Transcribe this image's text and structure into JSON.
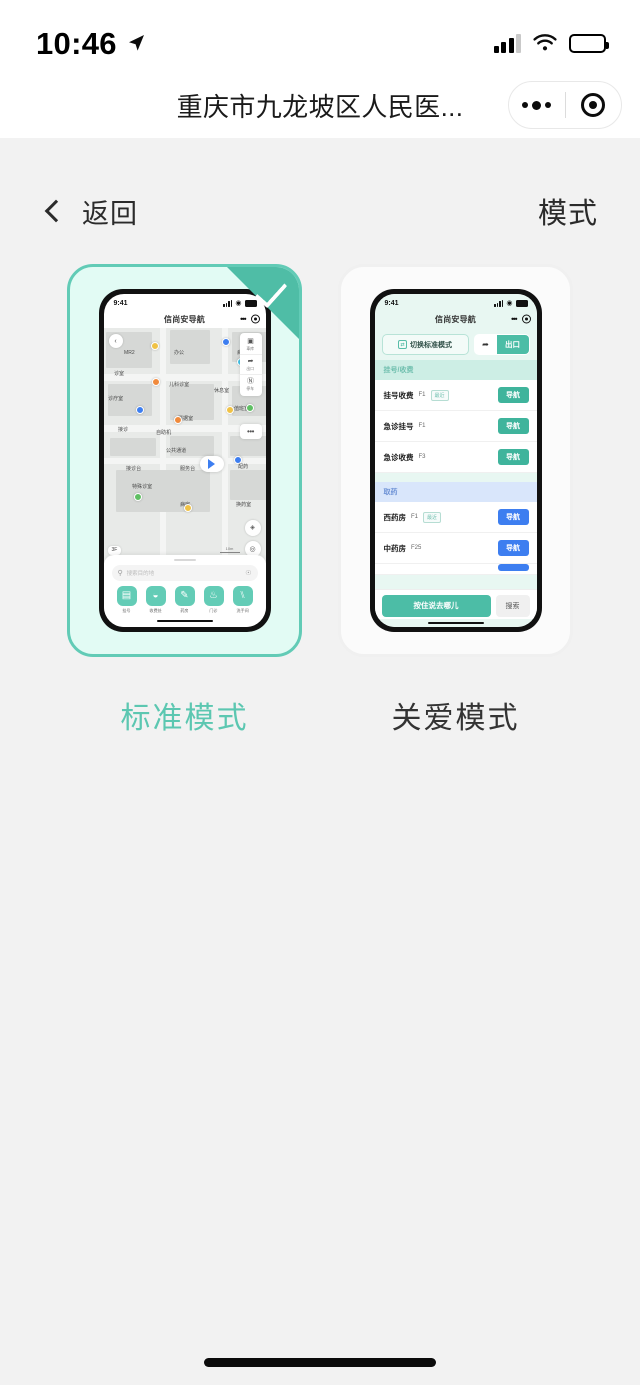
{
  "status_bar": {
    "time": "10:46",
    "location_icon": "location-arrow-icon",
    "signal_icon": "cellular-signal-icon",
    "wifi_icon": "wifi-icon",
    "battery_icon": "battery-icon"
  },
  "nav_bar": {
    "title": "重庆市九龙坡区人民医...",
    "more_icon": "more-dots-icon",
    "capsule_target_icon": "target-circle-icon"
  },
  "page": {
    "back_label": "返回",
    "back_icon": "chevron-left-icon",
    "title": "模式"
  },
  "modes": [
    {
      "id": "standard",
      "caption": "标准模式",
      "selected": true,
      "check_icon": "check-icon",
      "preview": {
        "status_time": "9:41",
        "app_title": "信尚安导航",
        "map_back_icon": "chevron-left-icon",
        "map_labels": [
          "MR2",
          "办公",
          "病房",
          "诊室",
          "儿科诊室",
          "休息室",
          "更衣",
          "诊疗室",
          "票据室",
          "值班室",
          "服务台",
          "接诊",
          "自助机",
          "公共通道",
          "接诊台",
          "服务台",
          "配药",
          "特殊诊室",
          "病房",
          "换药室"
        ],
        "tools": [
          {
            "icon": "car-garage-icon",
            "label": "車库"
          },
          {
            "icon": "exit-door-icon",
            "label": "出口"
          },
          {
            "icon": "parking-p-icon",
            "label": "停车"
          }
        ],
        "more_icon": "more-dots-icon",
        "locator_icon": "navigation-arrow-icon",
        "compass_icon": "compass-icon",
        "recenter_icon": "recenter-icon",
        "floor_badge": "3F",
        "scale_label": "10m",
        "search_placeholder": "搜索目的地",
        "search_icon": "search-icon",
        "mic_icon": "microphone-icon",
        "quick_actions": [
          {
            "icon": "registration-icon",
            "glyph": "▤",
            "label": "挂号"
          },
          {
            "icon": "cashier-icon",
            "glyph": "◒",
            "label": "收费处"
          },
          {
            "icon": "pharmacy-icon",
            "glyph": "✎",
            "label": "药房"
          },
          {
            "icon": "clinic-icon",
            "glyph": "♨",
            "label": "门诊"
          },
          {
            "icon": "restroom-icon",
            "glyph": "⑊",
            "label": "洗手间"
          }
        ]
      }
    },
    {
      "id": "care",
      "caption": "关爱模式",
      "selected": false,
      "preview": {
        "status_time": "9:41",
        "app_title": "信尚安导航",
        "switch_button": {
          "label": "切换标准模式",
          "icon": "switch-mode-icon"
        },
        "exit_button": {
          "label": "出口",
          "icon": "exit-door-icon"
        },
        "sections": [
          {
            "title": "挂号/收费",
            "accent": "#6fbfae",
            "header_bg": "#cdeee5",
            "button_color": "#3fb49c",
            "rows": [
              {
                "name": "挂号收费",
                "floor": "F1",
                "tag": "最近",
                "action": "导航"
              },
              {
                "name": "急诊挂号",
                "floor": "F1",
                "tag": "",
                "action": "导航"
              },
              {
                "name": "急诊收费",
                "floor": "F3",
                "tag": "",
                "action": "导航"
              }
            ]
          },
          {
            "title": "取药",
            "accent": "#6f93d6",
            "header_bg": "#d9e6fb",
            "button_color": "#3d7ef0",
            "rows": [
              {
                "name": "西药房",
                "floor": "F1",
                "tag": "最近",
                "action": "导航"
              },
              {
                "name": "中药房",
                "floor": "F25",
                "tag": "",
                "action": "导航"
              }
            ]
          }
        ],
        "hold_to_speak": "按住说去哪儿",
        "search_label": "搜索"
      }
    }
  ],
  "theme": {
    "accent": "#5cc7b1",
    "selected_card_bg": "#e2fbf4",
    "selected_card_border": "#62cbb6",
    "badge_color": "#4fbda6",
    "page_bg": "#f2f2f2",
    "blue": "#3d7ef0"
  }
}
